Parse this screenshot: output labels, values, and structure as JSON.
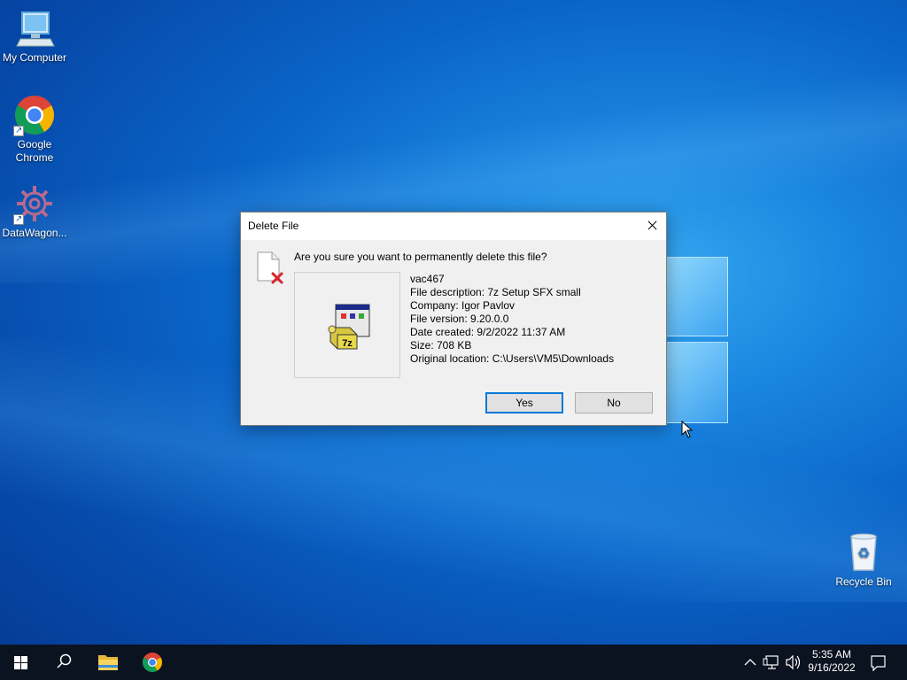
{
  "desktop": {
    "icons": [
      {
        "label": "My Computer",
        "icon": "monitor-icon"
      },
      {
        "label": "Google Chrome",
        "icon": "chrome-icon"
      },
      {
        "label": "DataWagon...",
        "icon": "datawagon-gear-icon"
      },
      {
        "label": "Recycle Bin",
        "icon": "recycle-bin-icon"
      }
    ]
  },
  "dialog": {
    "title": "Delete File",
    "question": "Are you sure you want to permanently delete this file?",
    "file_name": "vac467",
    "description": "File description: 7z Setup SFX small",
    "company": "Company: Igor Pavlov",
    "version": "File version: 9.20.0.0",
    "date_created": "Date created: 9/2/2022 11:37 AM",
    "size": "Size: 708 KB",
    "original_location": "Original location: C:\\Users\\VM5\\Downloads",
    "preview_badge": "7z",
    "yes_label": "Yes",
    "no_label": "No"
  },
  "taskbar": {
    "items": [
      "start-icon",
      "search-icon",
      "file-explorer-icon",
      "chrome-icon"
    ],
    "tray": [
      "chevron-up-icon",
      "network-icon",
      "volume-icon"
    ],
    "time": "5:35 AM",
    "date": "9/16/2022",
    "notification_icon": "notification-icon"
  },
  "colors": {
    "accent": "#0078d7",
    "taskbar": "#0b1220"
  }
}
